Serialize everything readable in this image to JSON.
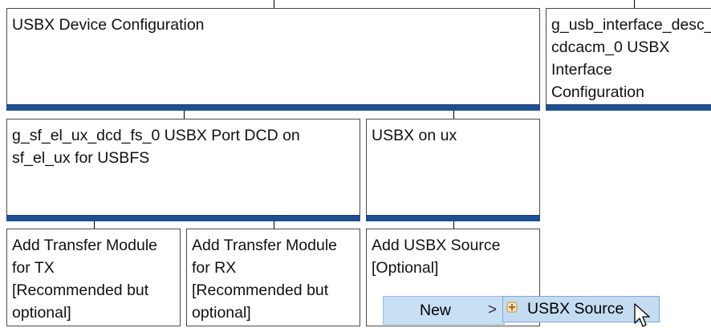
{
  "modules": {
    "usbx_device_config": {
      "label": "USBX Device Configuration"
    },
    "interface_desc": {
      "label": "g_usb_interface_desc_\ncdcacm_0 USBX\nInterface\nConfiguration"
    },
    "port_dcd": {
      "label": "g_sf_el_ux_dcd_fs_0 USBX Port DCD on\nsf_el_ux for USBFS"
    },
    "usbx_on_ux": {
      "label": "USBX on ux"
    },
    "transfer_tx": {
      "label": "Add Transfer Module\nfor TX\n[Recommended but\noptional]"
    },
    "transfer_rx": {
      "label": "Add Transfer Module\nfor RX\n[Recommended but\noptional]"
    },
    "usbx_source": {
      "label": "Add USBX Source\n[Optional]"
    }
  },
  "context_menu": {
    "new_label": "New",
    "submenu_arrow": ">",
    "submenu_item_label": "USBX Source",
    "submenu_item_icon": "component-icon"
  },
  "colors": {
    "module_bar": "#1e4f8f",
    "menu_highlight": "#c8dff4"
  }
}
